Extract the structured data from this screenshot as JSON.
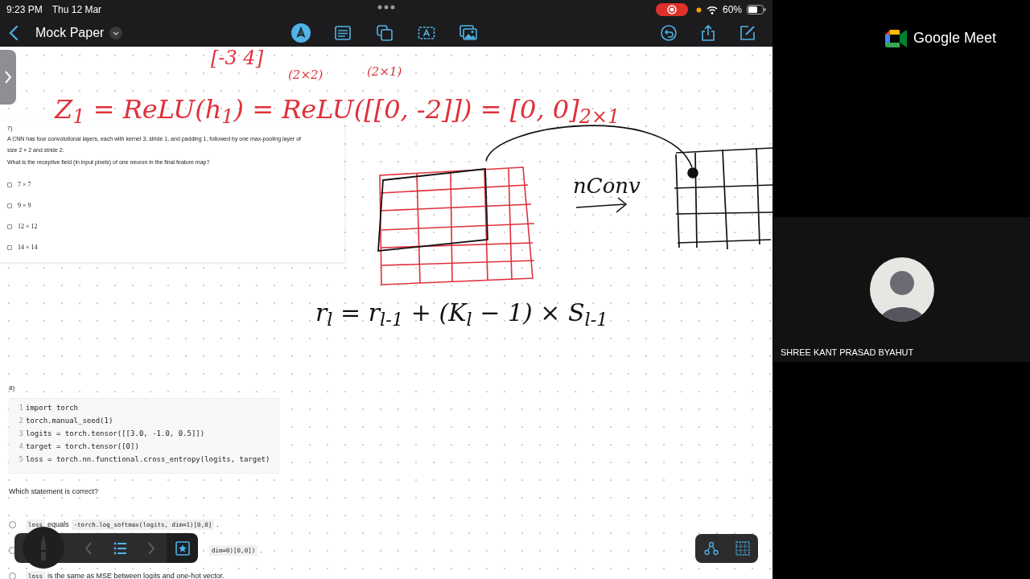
{
  "status_bar": {
    "time": "9:23 PM",
    "date": "Thu 12 Mar",
    "recording": true,
    "battery": "60%"
  },
  "toolbar": {
    "title": "Mock Paper",
    "tools": [
      {
        "kind": "pen",
        "selected": true
      },
      {
        "kind": "text",
        "selected": false
      },
      {
        "kind": "shapes",
        "selected": false
      },
      {
        "kind": "textbox",
        "selected": false
      },
      {
        "kind": "image",
        "selected": false
      }
    ],
    "actions": [
      {
        "kind": "undo"
      },
      {
        "kind": "share"
      },
      {
        "kind": "compose"
      }
    ]
  },
  "handwritten_notes": [
    {
      "text": "[-3  4]",
      "color": "#e0303a"
    },
    {
      "text": "(2×2)",
      "color": "#e0303a"
    },
    {
      "text": "(2×1)",
      "color": "#e0303a"
    },
    {
      "text": "Z$_{1}$ = ReLU(h$_{1}$) = ReLU([[0, -2]]) = [0, 0]$_{2×1}$",
      "color": "#e0303a"
    },
    {
      "text": "nConv",
      "color": "#111111"
    },
    {
      "text": "r$_{l}$ = r$_{l-1}$ + (K$_{l}$ − 1) × S$_{l-1}$",
      "color": "#111111"
    }
  ],
  "question_7": {
    "number": "7)",
    "paragraphs": [
      "A CNN has four convolutional layers, each with kernel 3, stride 1, and padding 1, followed by one max-pooling layer of size 2 × 2 and stride 2.",
      "What is the receptive field (in input pixels) of one neuron in the final feature map?"
    ],
    "options": [
      {
        "label": "7 × 7",
        "checked": false
      },
      {
        "label": "9 × 9",
        "checked": false
      },
      {
        "label": "12 × 12",
        "checked": false
      },
      {
        "label": "14 × 14",
        "checked": false
      }
    ]
  },
  "question_8": {
    "number": "8)",
    "code_lines": [
      {
        "number": "1",
        "code": "import torch"
      },
      {
        "number": "2",
        "code": "torch.manual_seed(1)"
      },
      {
        "number": "3",
        "code": "logits = torch.tensor([[3.0, -1.0, 0.5]])"
      },
      {
        "number": "4",
        "code": "target = torch.tensor([0])"
      },
      {
        "number": "5",
        "code": "loss = torch.nn.functional.cross_entropy(logits, target)"
      }
    ],
    "prompt": "Which statement is correct?",
    "options": [
      {
        "selected": false,
        "parts": [
          {
            "kind": "code",
            "text": "loss"
          },
          {
            "kind": "text",
            "text": "equals"
          },
          {
            "kind": "code",
            "text": "-torch.log_softmax(logits, dim=1)[0,0]"
          },
          {
            "kind": "text",
            "text": "."
          }
        ]
      },
      {
        "selected": false,
        "parts": [
          {
            "kind": "code",
            "text": "dim=0)[0,0])"
          },
          {
            "kind": "text",
            "text": "."
          }
        ]
      },
      {
        "selected": false,
        "parts": [
          {
            "kind": "code",
            "text": "loss"
          },
          {
            "kind": "text",
            "text": "is the same as MSE between logits and one-hot vector."
          }
        ]
      }
    ]
  },
  "floating_toolbar": [
    {
      "kind": "back",
      "selected": false
    },
    {
      "kind": "list",
      "selected": false
    },
    {
      "kind": "forward",
      "selected": false
    },
    {
      "kind": "favorite",
      "selected": true
    }
  ],
  "meet": {
    "brand": "Google Meet",
    "participant": {
      "name": "SHREE KANT PRASAD BYAHUT"
    }
  }
}
